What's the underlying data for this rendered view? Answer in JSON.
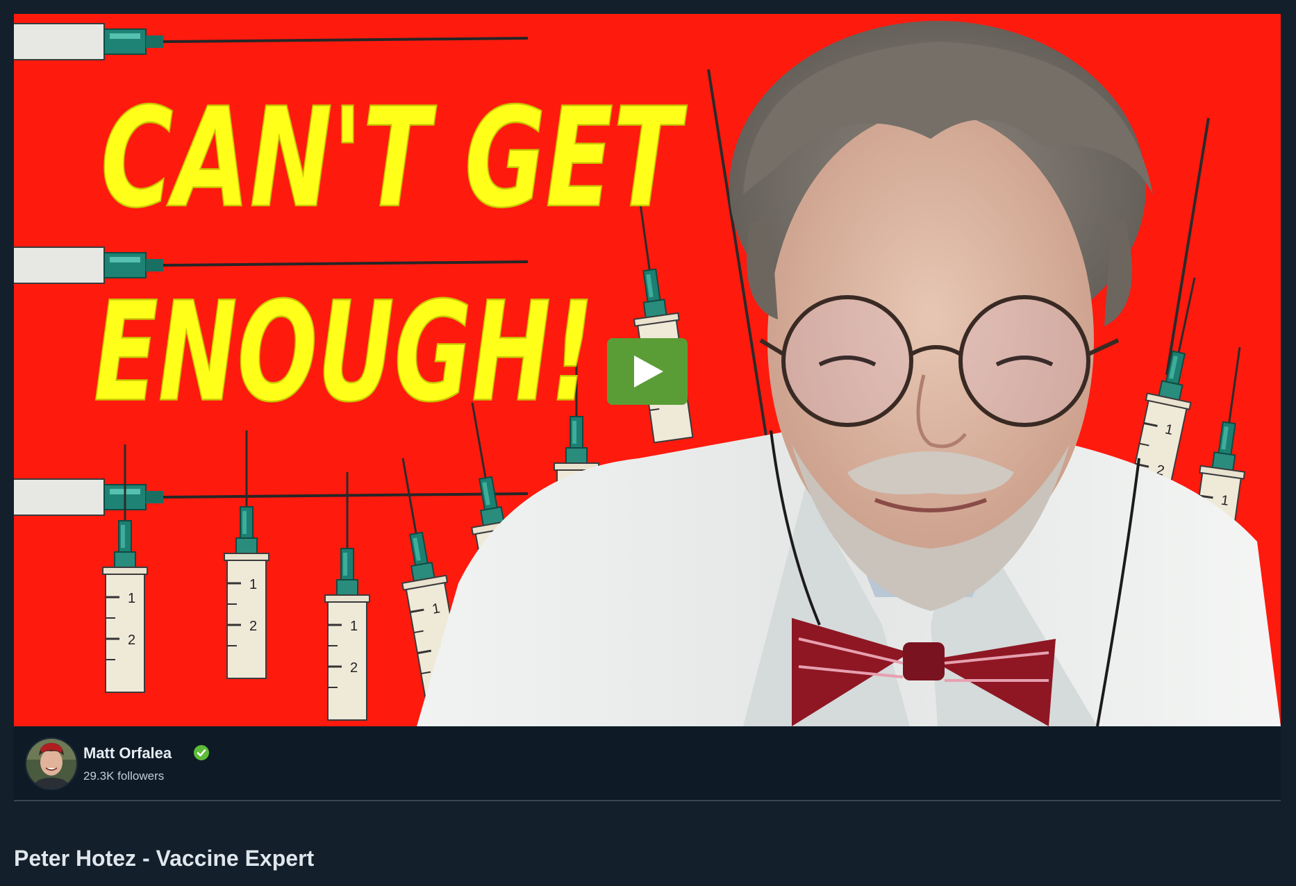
{
  "video": {
    "thumbnail_text_line1": "CAN'T GET",
    "thumbnail_text_line2": "ENOUGH!",
    "play_icon": "play-icon",
    "play_button_color": "#5a9d36",
    "thumbnail_background_color": "#ff1a0e",
    "thumbnail_text_color": "#ffff1a"
  },
  "creator": {
    "name": "Matt Orfalea",
    "verified_icon": "verified-check-icon",
    "verified_color": "#5dbb3a",
    "followers": "29.3K followers"
  },
  "title": "Peter Hotez - Vaccine Expert"
}
